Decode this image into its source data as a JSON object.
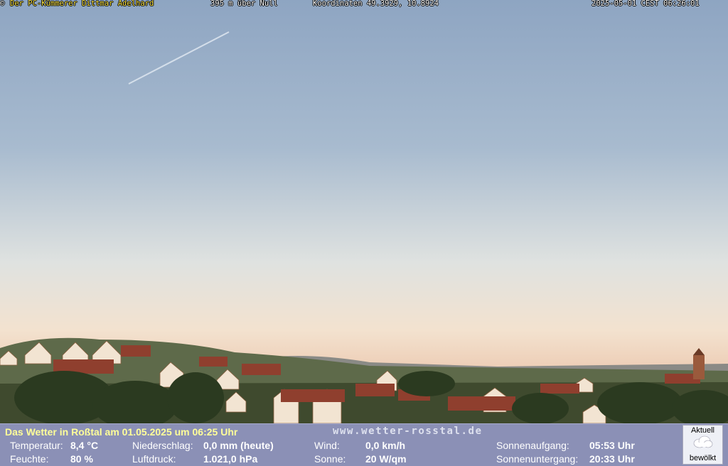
{
  "overlay": {
    "copyright": "©",
    "owner": "Der PC-Kümmerer Dittmar Adelhard",
    "altitude": "395 m über Null",
    "coordinates": "Koordinaten 49.3929, 10.8924",
    "timestamp": "2025-05-01 CEST 06:26:01"
  },
  "panel": {
    "title": "Das Wetter in Roßtal am 01.05.2025 um 06:25 Uhr",
    "site": "www.wetter-rosstal.de",
    "temperature": {
      "label": "Temperatur:",
      "value": "8,4 °C"
    },
    "humidity": {
      "label": "Feuchte:",
      "value": "80 %"
    },
    "precipitation": {
      "label": "Niederschlag:",
      "value": "0,0 mm (heute)"
    },
    "pressure": {
      "label": "Luftdruck:",
      "value": "1.021,0 hPa"
    },
    "wind": {
      "label": "Wind:",
      "value": "0,0 km/h"
    },
    "sun": {
      "label": "Sonne:",
      "value": "20 W/qm"
    },
    "sunrise": {
      "label": "Sonnenaufgang:",
      "value": "05:53 Uhr"
    },
    "sunset": {
      "label": "Sonnenuntergang:",
      "value": "20:33 Uhr"
    },
    "condition": {
      "heading": "Aktuell",
      "text": "bewölkt",
      "icon": "cloud-icon"
    }
  },
  "colors": {
    "sky_top": "#8da4c1",
    "sky_horizon": "#f2dcc8",
    "panel_bg": "#8b90b6",
    "title_text": "#ffff99",
    "overlay_text": "#ffe84a"
  }
}
